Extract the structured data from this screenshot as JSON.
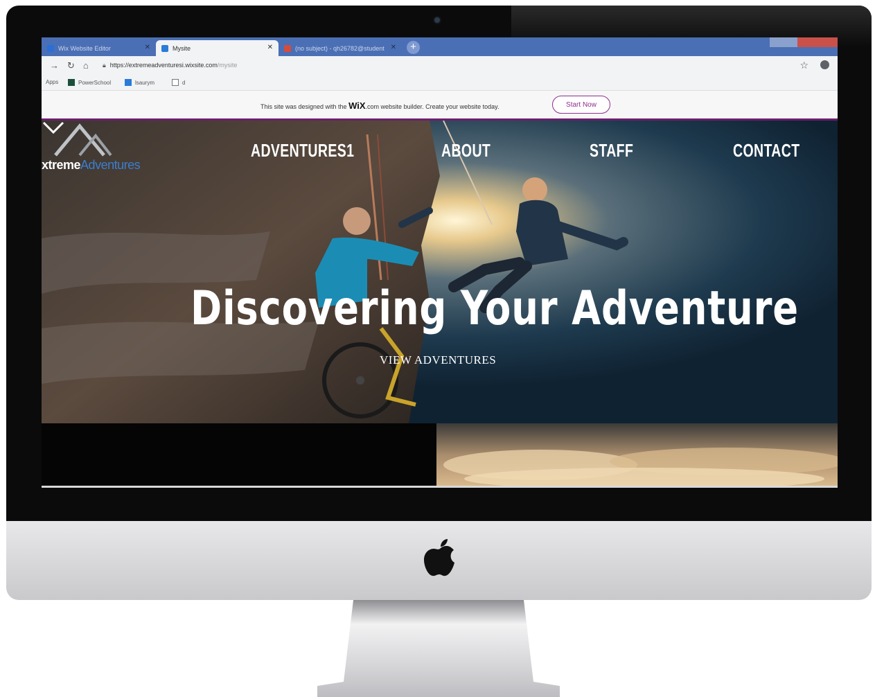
{
  "browser": {
    "tabs": [
      {
        "title": "Wix Website Editor",
        "icon": "wix-icon",
        "active": false
      },
      {
        "title": "Mysite",
        "icon": "wix-favicon",
        "active": true
      },
      {
        "title": "(no subject) - qh26782@student",
        "icon": "gmail-icon",
        "active": false
      }
    ],
    "new_tab": "+",
    "url_host": "https://extremeadventuresi.wixsite.com",
    "url_path": "/mysite",
    "bookmarks": [
      {
        "label": "Apps",
        "icon": "apps-icon"
      },
      {
        "label": "PowerSchool",
        "icon": "powerschool-icon"
      },
      {
        "label": "lsaurym",
        "icon": "wix-icon"
      },
      {
        "label": "d",
        "icon": "page-icon"
      }
    ]
  },
  "wix_banner": {
    "text_before": "This site was designed with the",
    "brand": "WiX",
    "text_after": ".com website builder. Create your website today.",
    "button": "Start Now"
  },
  "site": {
    "logo_prefix": "xtreme",
    "logo_suffix": "Adventures",
    "nav": [
      "ADVENTURES1",
      "ABOUT",
      "STAFF",
      "CONTACT"
    ],
    "headline": "Discovering Your Adventure",
    "cta": "VIEW ADVENTURES"
  },
  "colors": {
    "wix_accent": "#8e2d8e",
    "tab_bar": "#4a6fb5",
    "logo_blue": "#3a7fd0"
  }
}
